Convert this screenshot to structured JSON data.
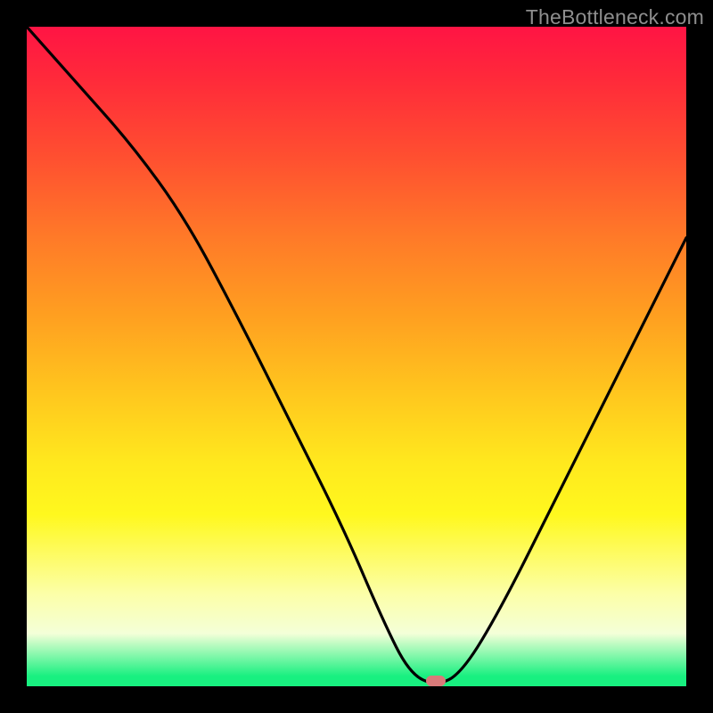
{
  "watermark": "TheBottleneck.com",
  "marker": {
    "x_pct": 62,
    "y_pct": 99.2
  },
  "chart_data": {
    "type": "line",
    "title": "",
    "xlabel": "",
    "ylabel": "",
    "xlim": [
      0,
      100
    ],
    "ylim": [
      0,
      100
    ],
    "series": [
      {
        "name": "bottleneck-curve",
        "x": [
          0,
          8,
          16,
          24,
          32,
          40,
          48,
          54,
          58,
          62,
          66,
          72,
          80,
          90,
          100
        ],
        "values": [
          100,
          91,
          82,
          71,
          56,
          40,
          24,
          10,
          2,
          0,
          2,
          12,
          28,
          48,
          68
        ]
      }
    ],
    "background_gradient": {
      "direction": "top-to-bottom",
      "stops": [
        {
          "pct": 0,
          "color": "#ff1444"
        },
        {
          "pct": 8,
          "color": "#ff2a3a"
        },
        {
          "pct": 20,
          "color": "#ff5030"
        },
        {
          "pct": 32,
          "color": "#ff7a28"
        },
        {
          "pct": 44,
          "color": "#ffa020"
        },
        {
          "pct": 56,
          "color": "#ffc81e"
        },
        {
          "pct": 66,
          "color": "#ffe81e"
        },
        {
          "pct": 74,
          "color": "#fff81e"
        },
        {
          "pct": 86,
          "color": "#fcffa8"
        },
        {
          "pct": 92,
          "color": "#f4ffd8"
        },
        {
          "pct": 98.5,
          "color": "#18f080"
        },
        {
          "pct": 100,
          "color": "#18f080"
        }
      ]
    },
    "marker": {
      "x": 62,
      "y": 0,
      "color": "#d97a7a"
    }
  }
}
